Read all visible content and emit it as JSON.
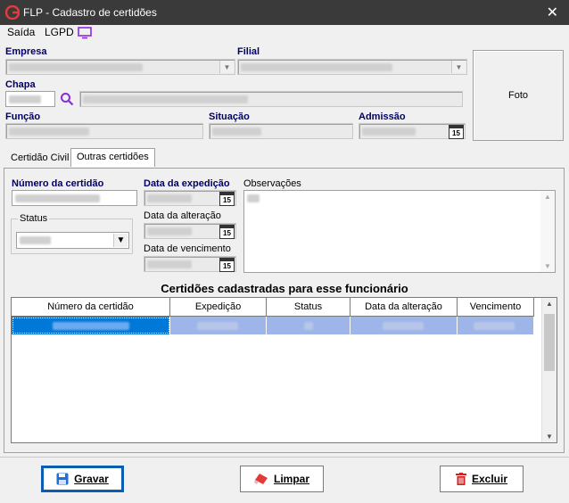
{
  "window": {
    "title": "FLP - Cadastro de certidões",
    "close_icon": "close-icon"
  },
  "menu": {
    "items": [
      "Saída",
      "LGPD"
    ],
    "lgpd_icon": "monitor-icon"
  },
  "header": {
    "empresa_label": "Empresa",
    "filial_label": "Filial",
    "chapa_label": "Chapa",
    "funcao_label": "Função",
    "situacao_label": "Situação",
    "admissao_label": "Admissão",
    "foto_label": "Foto",
    "search_icon": "magnifier-icon"
  },
  "tabs": [
    {
      "label": "Certidão Civil",
      "active": false
    },
    {
      "label": "Outras certidões",
      "active": true
    }
  ],
  "form": {
    "numero_label": "Número da certidão",
    "data_expedicao_label": "Data da expedição",
    "observacoes_label": "Observações",
    "status_label": "Status",
    "data_alteracao_label": "Data da alteração",
    "data_vencimento_label": "Data de vencimento",
    "calendar_icon_text": "15"
  },
  "grid": {
    "title": "Certidões cadastradas para esse funcionário",
    "columns": [
      "Número da certidão",
      "Expedição",
      "Status",
      "Data da alteração",
      "Vencimento"
    ]
  },
  "buttons": {
    "gravar": "Gravar",
    "limpar": "Limpar",
    "excluir": "Excluir"
  },
  "colors": {
    "titlebar": "#3a3a3a",
    "accent": "#0a5db0",
    "selected_row": "#9db5e8"
  }
}
